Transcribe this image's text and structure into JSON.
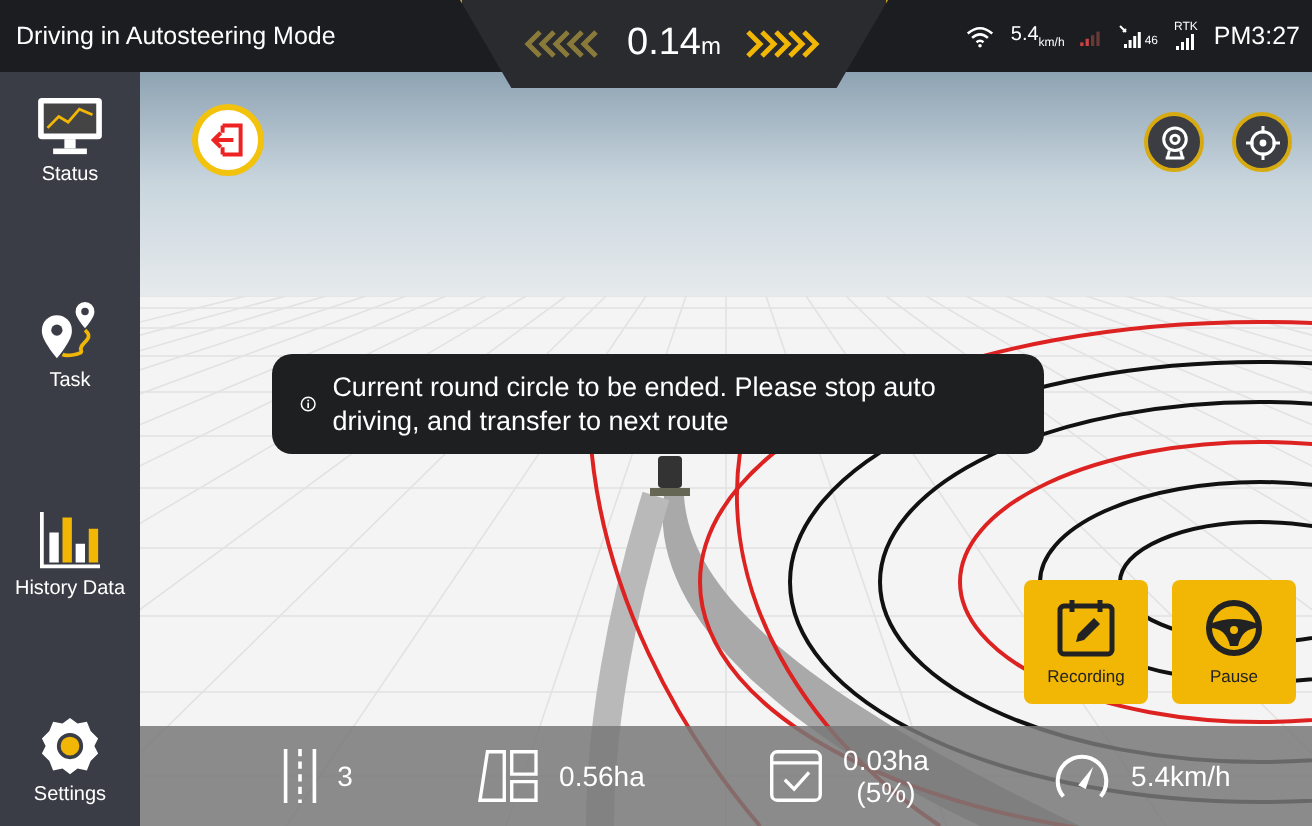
{
  "status_bar": {
    "title": "Driving in Autosteering Mode",
    "offset": {
      "value": "0.14",
      "unit": "m"
    },
    "speed": {
      "value": "5.4",
      "unit": "km/h"
    },
    "satellites": "46",
    "rtk_label": "RTK",
    "time": "PM3:27"
  },
  "sidebar": {
    "items": [
      {
        "kind": "status",
        "label": "Status",
        "selected": false
      },
      {
        "kind": "task",
        "label": "Task",
        "selected": false
      },
      {
        "kind": "history",
        "label": "History Data",
        "selected": false
      },
      {
        "kind": "settings",
        "label": "Settings",
        "selected": false
      }
    ]
  },
  "notice": {
    "text": "Current round circle to be ended. Please stop auto driving, and transfer to next route"
  },
  "actions": [
    {
      "kind": "recording",
      "label": "Recording"
    },
    {
      "kind": "pause",
      "label": "Pause"
    }
  ],
  "stats": [
    {
      "kind": "lines",
      "value": "3"
    },
    {
      "kind": "area",
      "value": "0.56ha"
    },
    {
      "kind": "done",
      "value": "0.03ha",
      "sub": "(5%)"
    },
    {
      "kind": "speed",
      "value": "5.4km/h"
    }
  ]
}
